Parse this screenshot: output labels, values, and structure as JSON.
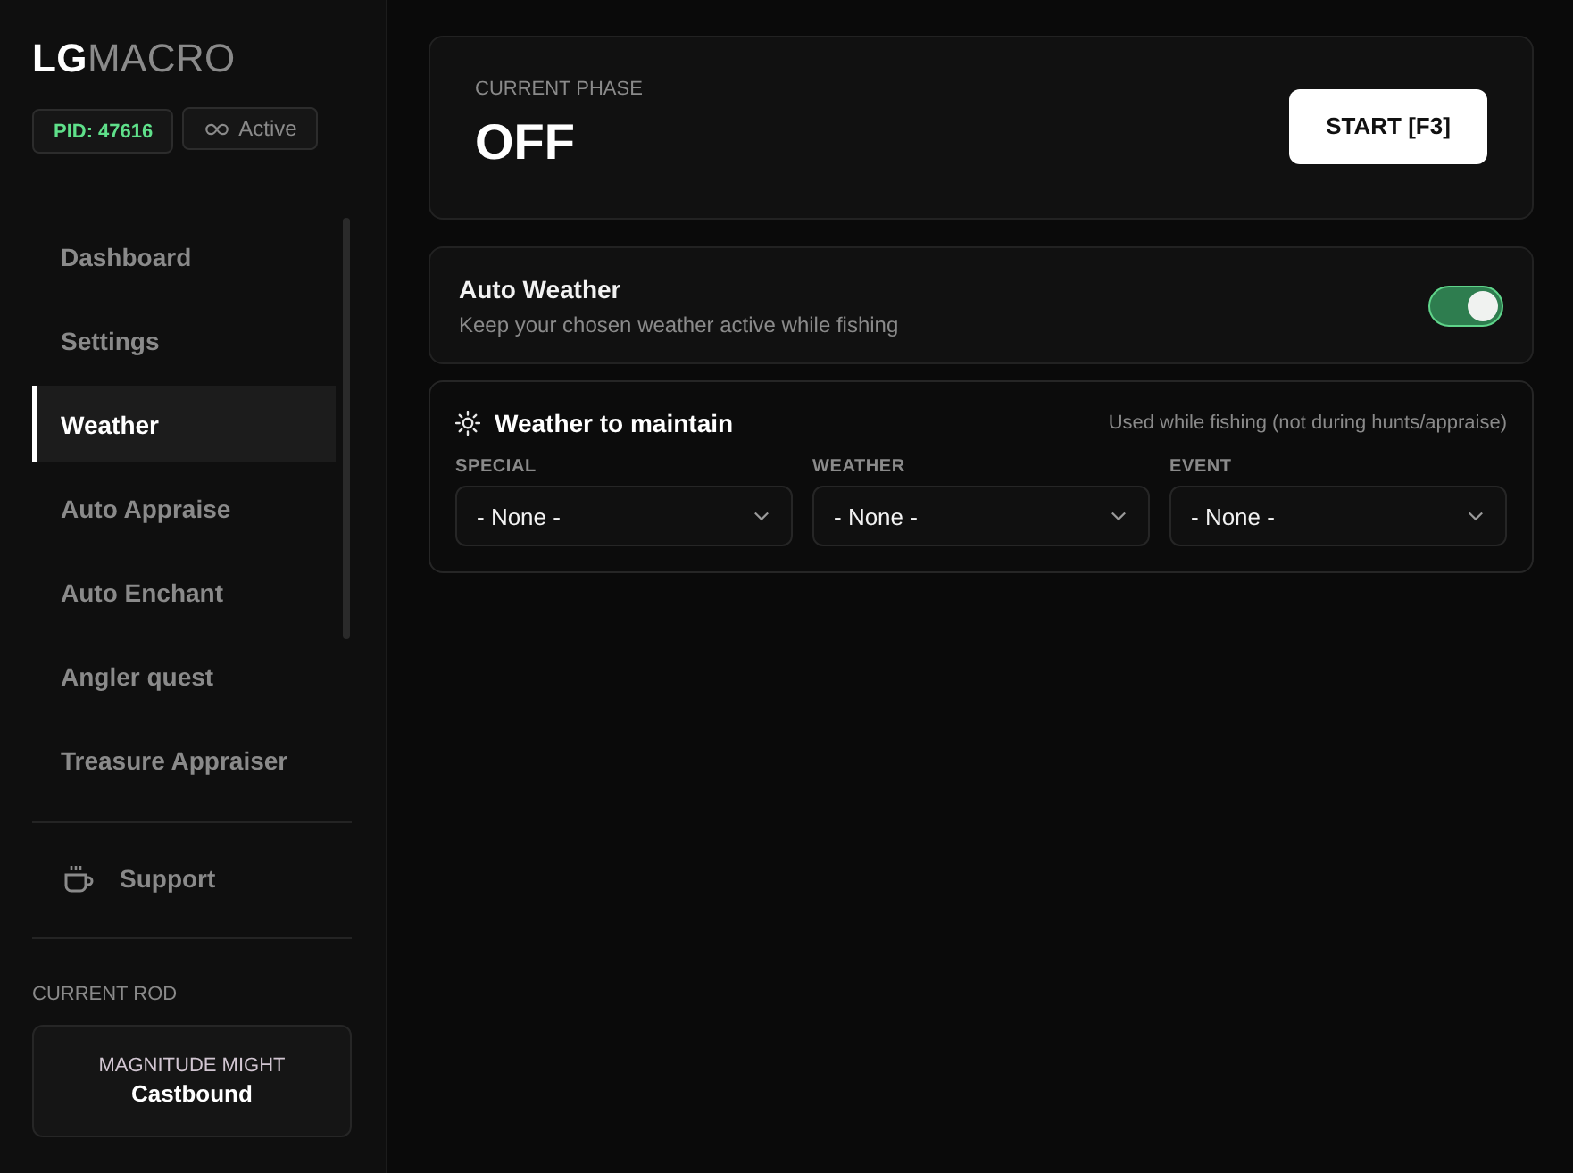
{
  "sidebar": {
    "logo": {
      "accent": "LG",
      "rest": "MACRO"
    },
    "badges": [
      {
        "kind": "pid",
        "text": "PID: 47616"
      },
      {
        "kind": "status",
        "text": "Active"
      }
    ],
    "nav_items": [
      {
        "label": "Dashboard",
        "selected": false
      },
      {
        "label": "Settings",
        "selected": false
      },
      {
        "label": "Weather",
        "selected": true
      },
      {
        "label": "Auto Appraise",
        "selected": false
      },
      {
        "label": "Auto Enchant",
        "selected": false
      },
      {
        "label": "Angler quest",
        "selected": false
      },
      {
        "label": "Treasure Appraiser",
        "selected": false
      }
    ],
    "support": {
      "label": "Support"
    },
    "current_rod": {
      "heading": "CURRENT ROD",
      "name": "MAGNITUDE MIGHT",
      "title": "Castbound"
    }
  },
  "phase_card": {
    "label": "CURRENT PHASE",
    "value": "OFF",
    "button": "START [F3]"
  },
  "auto_weather": {
    "title": "Auto Weather",
    "description": "Keep your chosen weather active while fishing",
    "on": true
  },
  "weather_section": {
    "title": "Weather to maintain",
    "note": "Used while fishing (not during hunts/appraise)",
    "fields": [
      {
        "label": "SPECIAL",
        "value": "- None -"
      },
      {
        "label": "WEATHER",
        "value": "- None -"
      },
      {
        "label": "EVENT",
        "value": "- None -"
      }
    ]
  }
}
